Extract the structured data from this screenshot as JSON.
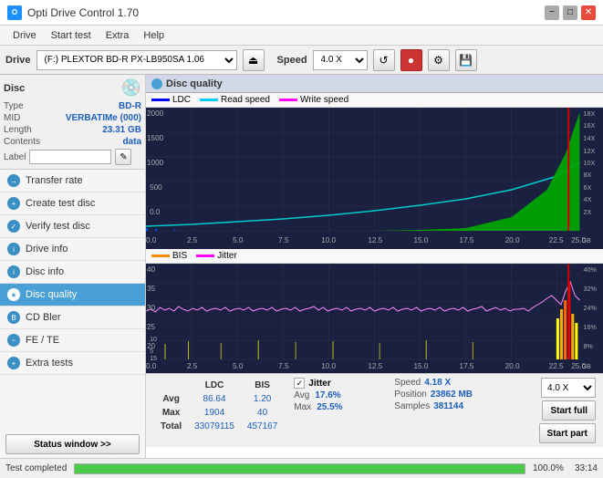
{
  "app": {
    "title": "Opti Drive Control 1.70",
    "icon": "O"
  },
  "titlebar": {
    "min": "−",
    "max": "□",
    "close": "✕"
  },
  "menu": {
    "items": [
      "Drive",
      "Start test",
      "Extra",
      "Help"
    ]
  },
  "toolbar": {
    "drive_label": "Drive",
    "drive_value": "(F:) PLEXTOR BD-R  PX-LB950SA 1.06",
    "speed_label": "Speed",
    "speed_value": "4.0 X"
  },
  "disc": {
    "section_title": "Disc",
    "type_label": "Type",
    "type_value": "BD-R",
    "mid_label": "MID",
    "mid_value": "VERBATIMe (000)",
    "length_label": "Length",
    "length_value": "23.31 GB",
    "contents_label": "Contents",
    "contents_value": "data",
    "label_label": "Label"
  },
  "nav": {
    "items": [
      {
        "id": "transfer-rate",
        "label": "Transfer rate",
        "icon": "→"
      },
      {
        "id": "create-test-disc",
        "label": "Create test disc",
        "icon": "+"
      },
      {
        "id": "verify-test-disc",
        "label": "Verify test disc",
        "icon": "✓"
      },
      {
        "id": "drive-info",
        "label": "Drive info",
        "icon": "i"
      },
      {
        "id": "disc-info",
        "label": "Disc info",
        "icon": "i"
      },
      {
        "id": "disc-quality",
        "label": "Disc quality",
        "icon": "★",
        "active": true
      },
      {
        "id": "cd-bler",
        "label": "CD Bler",
        "icon": "B"
      },
      {
        "id": "fe-te",
        "label": "FE / TE",
        "icon": "~"
      },
      {
        "id": "extra-tests",
        "label": "Extra tests",
        "icon": "+"
      }
    ],
    "status_btn": "Status window >>"
  },
  "chart": {
    "title": "Disc quality",
    "legend_top": [
      {
        "label": "LDC",
        "color": "#0000ff"
      },
      {
        "label": "Read speed",
        "color": "#00ccff"
      },
      {
        "label": "Write speed",
        "color": "#ff00ff"
      }
    ],
    "legend_bottom": [
      {
        "label": "BIS",
        "color": "#ff8c00"
      },
      {
        "label": "Jitter",
        "color": "#ff00ff"
      }
    ],
    "top_y_labels": [
      "2000",
      "1500",
      "1000",
      "500",
      "0.0"
    ],
    "top_y_right_labels": [
      "18X",
      "16X",
      "14X",
      "12X",
      "10X",
      "8X",
      "6X",
      "4X",
      "2X"
    ],
    "bottom_y_labels": [
      "40",
      "35",
      "30",
      "25",
      "20",
      "15",
      "10",
      "5"
    ],
    "bottom_y_right_labels": [
      "40%",
      "32%",
      "24%",
      "16%",
      "8%"
    ],
    "x_labels": [
      "0.0",
      "2.5",
      "5.0",
      "7.5",
      "10.0",
      "12.5",
      "15.0",
      "17.5",
      "20.0",
      "22.5",
      "25.0"
    ],
    "x_unit": "GB"
  },
  "stats": {
    "headers": [
      "",
      "LDC",
      "BIS"
    ],
    "avg_label": "Avg",
    "avg_ldc": "86.64",
    "avg_bis": "1.20",
    "max_label": "Max",
    "max_ldc": "1904",
    "max_bis": "40",
    "total_label": "Total",
    "total_ldc": "33079115",
    "total_bis": "457167",
    "jitter_label": "Jitter",
    "jitter_avg": "17.6%",
    "jitter_max": "25.5%",
    "speed_label": "Speed",
    "speed_value": "4.18 X",
    "position_label": "Position",
    "position_value": "23862 MB",
    "samples_label": "Samples",
    "samples_value": "381144",
    "speed_select": "4.0 X",
    "start_full": "Start full",
    "start_part": "Start part"
  },
  "statusbar": {
    "text": "Test completed",
    "progress": 100,
    "percent": "100.0%",
    "time": "33:14"
  }
}
